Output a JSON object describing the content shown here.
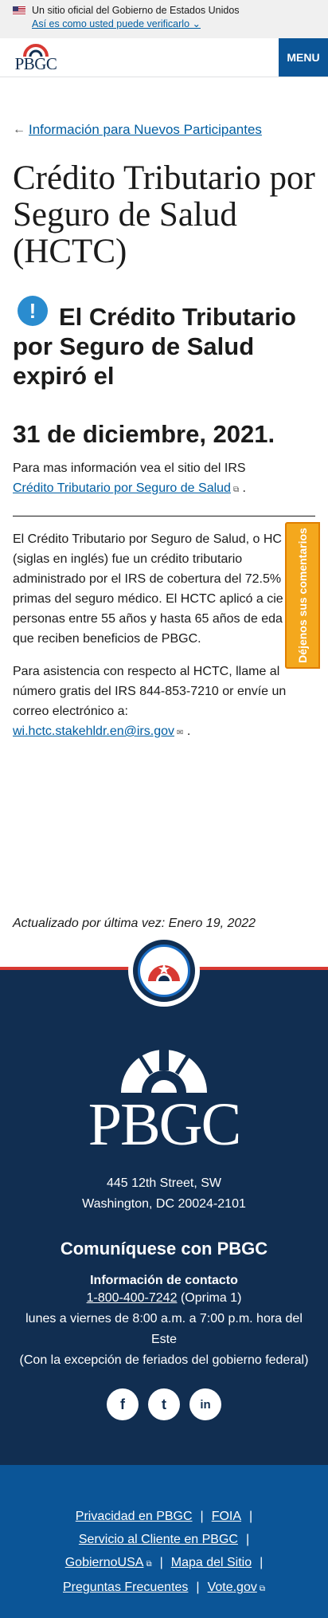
{
  "gov_banner": {
    "official": "Un sitio oficial del Gobierno de Estados Unidos",
    "verify": "Así es como usted puede verificarlo",
    "chevron": "chevron-down-icon"
  },
  "header": {
    "logo_text": "PBGC",
    "menu_label": "MENU"
  },
  "main": {
    "back_link": "Información para Nuevos Participantes",
    "title": "Crédito Tributario por Seguro de Salud (HCTC)",
    "alert_heading": "El Crédito Tributario por Seguro de Salud expiró el",
    "alert_date": "31 de diciembre, 2021.",
    "irs_intro": "Para mas información vea el sitio del IRS",
    "irs_link": "Crédito Tributario por Seguro de Salud",
    "irs_tail": ".",
    "para1": [
      "El Crédito Tributario por Seguro de Salud, o HC",
      "(siglas en inglés) fue un crédito tributario",
      "administrado por el IRS de cobertura del 72.5%",
      "primas del seguro médico. El HCTC aplicó a cie",
      "personas entre 55 años y hasta 65 años de eda",
      "que reciben beneficios de PBGC."
    ],
    "para2": [
      "Para asistencia con respecto al HCTC, llame al",
      "número gratis del IRS 844-853-7210 or envíe un",
      "correo electrónico a:"
    ],
    "email": "wi.hctc.stakehldr.en@irs.gov",
    "email_tail": ".",
    "updated": "Actualizado por última vez: Enero 19, 2022"
  },
  "feedback_label": "Déjenos sus comentarios",
  "footer": {
    "logo_text": "PBGC",
    "address_line1": "445 12th Street, SW",
    "address_line2": "Washington, DC 20024-2101",
    "contact_title": "Comuníquese con PBGC",
    "contact_sub": "Información de contacto",
    "phone": "1-800-400-7242",
    "phone_note": "(Oprima 1)",
    "hours1": "lunes a viernes de 8:00 a.m. a 7:00 p.m. hora del",
    "hours2": "Este",
    "holidays": "(Con la excepción de feriados del gobierno federal)",
    "social": [
      {
        "icon": "facebook-icon",
        "glyph": "f"
      },
      {
        "icon": "twitter-icon",
        "glyph": "t"
      },
      {
        "icon": "linkedin-icon",
        "glyph": "in"
      }
    ]
  },
  "subfooter": {
    "privacy": "Privacidad en PBGC",
    "foia": "FOIA",
    "customer": "Servicio al Cliente en PBGC",
    "usagov": "GobiernoUSA",
    "sitemap": "Mapa del Sitio",
    "faq": "Preguntas Frecuentes",
    "vote": "Vote.gov"
  },
  "colors": {
    "navy": "#112e51",
    "blue": "#0b5597",
    "link": "#005ea2",
    "red": "#d83933",
    "feedback": "#f4a81d"
  }
}
